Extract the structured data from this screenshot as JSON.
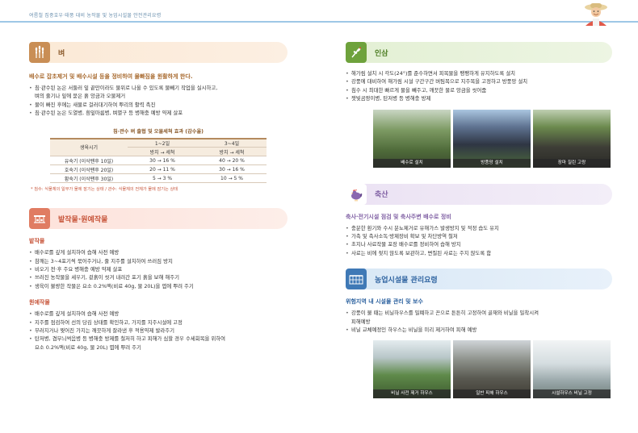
{
  "header": {
    "title": "여름철 집중호우·태풍 대비 농작물 및 농업시설물 안전관리요령"
  },
  "rice": {
    "title": "벼",
    "icon": "wheat-icon",
    "lead": "배수로 잡초제거 및 배수시설 등을 정비하여 물빠짐을 원활하게 한다.",
    "bullets": [
      {
        "l1": "침·관수된 논은 서둘러 잎 끝만이라도 물위로 나올 수 있도록 물빼기 작업을 실시하고,",
        "l2": "벼의 줄기나 잎에 묻은 흙 앙금과 오물제거"
      },
      {
        "l1": "물이 빠진 후에는 새물로 걸러대기하여 뿌리의 활력 촉진",
        "l2": ""
      },
      {
        "l1": "침·관수된 논은 도열병, 흰잎마름병, 벼멸구 등 병해충 예방 약제 살포",
        "l2": ""
      }
    ],
    "table": {
      "title": "침·관수 벼 출협 및 오물세척 효과 (감수율)",
      "col_head": "생육시기",
      "groups": [
        "1~2일",
        "3~4일"
      ],
      "sub_heads": [
        "방치 → 세척",
        "방치 → 세척",
        "방치 → 세척"
      ],
      "rows": [
        {
          "stage": "유숙기 (이삭팬후 10일)",
          "a": "30 → 16 %",
          "b": "40 → 20 %"
        },
        {
          "stage": "호숙기 (이삭팬후 20일)",
          "a": "20 → 11 %",
          "b": "30 → 16 %"
        },
        {
          "stage": "황숙기 (이삭팬후 30일)",
          "a": "5 → 3 %",
          "b": "10 → 5 %"
        }
      ],
      "note": "* 침수: 식물체의 일부가 물에 잠기는 상태 / 관수: 식물체의 전체가 물에 잠기는 상태"
    }
  },
  "field": {
    "title": "밭작물·원예작물",
    "icon": "greenhouse-icon",
    "sub1": "밭작물",
    "bullets1": [
      {
        "l1": "배수로를 깊게 설치하여 습해 사전 예방",
        "l2": ""
      },
      {
        "l1": "참깨는 3~4포기씩 묶어주거나, 줄 지주를 설치하여 쓰러짐 방지",
        "l2": ""
      },
      {
        "l1": "비오기 전·후 주요 병해충 예방 약제 살포",
        "l2": ""
      },
      {
        "l1": "쓰러진 농작물을 세우기, 겉흙이 씻겨 내려간 포기 흙을 보해 해주기",
        "l2": ""
      },
      {
        "l1": "생육이 불량한 작물은 요소 0.2%액(비료 40g, 물 20L)을 엽에 뿌려 주기",
        "l2": ""
      }
    ],
    "sub2": "원예작물",
    "bullets2": [
      {
        "l1": "배수로를 깊게 설치하여 습해 사전 예방",
        "l2": ""
      },
      {
        "l1": "지주를 점검하여 선의 당김 상태를 확인하고, 가지를 지주시설에 고정",
        "l2": ""
      },
      {
        "l1": "부러지거나 찢어진 가지는 깨끗하게 잘라낸 후 적용약제 발라주기",
        "l2": ""
      },
      {
        "l1": "탄저병, 겹무늬썩음병 등 병해충 방제를 철저히 하고 피해가 심할 경우 수세회복을 위하여",
        "l2": "요소 0.2%액(비료 40g, 물 20L) 엽에 뿌려 주기"
      }
    ]
  },
  "ginseng": {
    "title": "인삼",
    "icon": "ginseng-icon",
    "bullets": [
      {
        "l1": "해가림 설치 시 각도(24°)를 준수하면서 피복물을 팽팽하게 유지하도록 설치",
        "l2": ""
      },
      {
        "l1": "강풍에 대비하여 해가림 시설 구간구간 버팀목으로 지주목을 고정하고 방풍망 설치",
        "l2": ""
      },
      {
        "l1": "침수 시 최대한 빠르게 물을 빼주고, 깨끗한 물로 앙금을 씻어줌",
        "l2": ""
      },
      {
        "l1": "잿빛곰팡이병, 탄저병 등 병해충 방제",
        "l2": ""
      }
    ],
    "photos": [
      "배수로 설치",
      "방풍망 설치",
      "장마 질린 고랑"
    ]
  },
  "livestock": {
    "title": "축산",
    "icon": "rooster-icon",
    "sub": "축사·전기시설 점검 및 축사주변 배수로 정비",
    "bullets": [
      {
        "l1": "충분한 환기와 수시 분뇨제거로 유해가스 발생방지 및 적정 습도 유지",
        "l2": ""
      },
      {
        "l1": "가축 및 축사소독·방제장비 확보 및 차단방역 철저",
        "l2": ""
      },
      {
        "l1": "초지나 사료작물 포장 배수로를 정비하여 습해 방지",
        "l2": ""
      },
      {
        "l1": "사료는 비에 젖지 않도록 보관하고, 변질된 사료는 주지 않도록 함",
        "l2": ""
      }
    ]
  },
  "facility": {
    "title": "농업시설물 관리요령",
    "icon": "greenhouse-frame-icon",
    "sub": "위험지역 내 시설물 관리 및 보수",
    "bullets": [
      {
        "l1": "강풍이 불 때는 비닐하우스를 밀폐하고 끈으로 튼튼히 고정하여 골재와 비닐을 밀착시켜",
        "l2": "피해예방"
      },
      {
        "l1": "비닐 교체예정인 하우스는 비닐을 미리 제거하여 피해 예방",
        "l2": ""
      }
    ],
    "photos": [
      "비닐 사전 제거 하우스",
      "일반 피해 하우스",
      "시설하우스 비닐 고정"
    ]
  },
  "colors": {
    "rice": "#c98e55",
    "field": "#e07c62",
    "ginseng": "#6ea23c",
    "livestock": "#7f5fa3",
    "facility": "#3f79b6"
  }
}
